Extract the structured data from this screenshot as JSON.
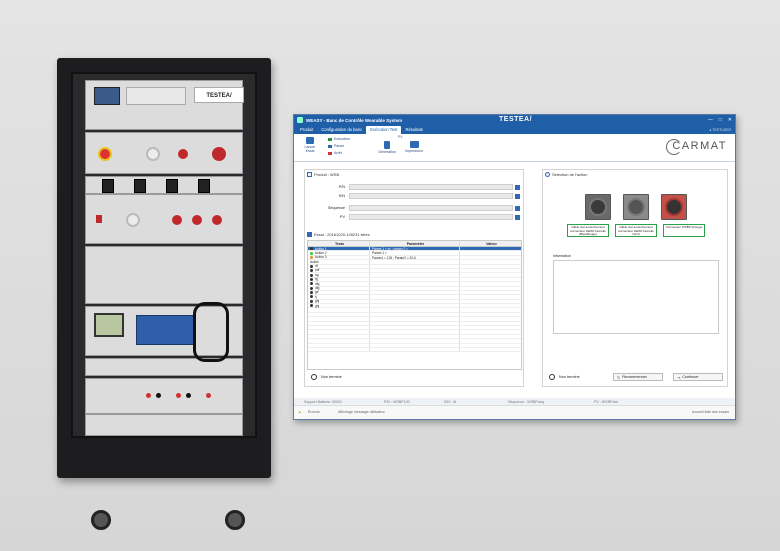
{
  "rack": {
    "brand_plate": "TESTEA/"
  },
  "app": {
    "title": "WEASY - Banc de Contrôle Wearable System",
    "logo": "TESTEA/",
    "window_controls": [
      "—",
      "□",
      "✕"
    ],
    "menu_tabs": [
      {
        "label": "Produit",
        "active": false
      },
      {
        "label": "Configuration du banc",
        "active": false
      },
      {
        "label": "Exécution Test",
        "active": true
      },
      {
        "label": "Résultats",
        "active": false
      }
    ],
    "user": "● TESTUSER",
    "ribbon": {
      "launch": "Lancer\nEssai",
      "controls": [
        "Exécution",
        "Pause",
        "Arrêt"
      ],
      "group_pv": "PV",
      "generation": "Génération",
      "impression": "Impression"
    },
    "brand": "CARMAT",
    "product": {
      "heading": "Produit : WSB",
      "fields": [
        {
          "label": "P/N"
        },
        {
          "label": "S/N"
        },
        {
          "label": "Séquence"
        },
        {
          "label": "PV"
        }
      ]
    },
    "essai": {
      "heading": "Essai : 20161020-145231.btres",
      "columns": [
        "Tests",
        "Paramètre",
        "Valeur"
      ],
      "rows": [
        {
          "name": "Action 1",
          "param": "Param 1 = xx ; param 2 =",
          "value": "",
          "status": "selected"
        },
        {
          "name": "Action 2",
          "param": "Param 1 =",
          "value": "",
          "status": "ok"
        },
        {
          "name": "Action 3",
          "param": "Param1 = 125 ; Param2 = 20.6",
          "value": "",
          "status": "warn"
        },
        {
          "name": "Action",
          "param": "",
          "value": "",
          "status": "none"
        },
        {
          "name": "df",
          "param": "",
          "value": "",
          "status": "dot"
        },
        {
          "name": "cdf",
          "param": "",
          "value": "",
          "status": "dot"
        },
        {
          "name": "ng",
          "param": "",
          "value": "",
          "status": "dot"
        },
        {
          "name": "fg",
          "param": "",
          "value": "",
          "status": "dot"
        },
        {
          "name": "dfg",
          "param": "",
          "value": "",
          "status": "dot"
        },
        {
          "name": "dfg",
          "param": "",
          "value": "",
          "status": "dot"
        },
        {
          "name": "ge",
          "param": "",
          "value": "",
          "status": "dot"
        },
        {
          "name": "fj",
          "param": "",
          "value": "",
          "status": "dot"
        },
        {
          "name": "ghj",
          "param": "",
          "value": "",
          "status": "dot"
        },
        {
          "name": "ghj",
          "param": "",
          "value": "",
          "status": "dot"
        }
      ],
      "footer": "Non terminé"
    },
    "action": {
      "heading": "Sélection de l'action",
      "captions": [
        "Câble test amenchement connecteur LEMO Femelle (Bleu/Rouge)",
        "Câble test amenchement connecteur LEMO Femelle (Vert)",
        "Connecteur WSBP (Rouge)"
      ],
      "info_label": "Information",
      "footer": "Non terminé",
      "restart": "Recommencer",
      "continue": "Continuer"
    },
    "status": {
      "support": "Support Batterie: 00001",
      "pn": "P/N : WSBP100",
      "sn": "S/N : df",
      "seq": "Séquence : WSBP.seq",
      "pv": "PV : WSBP.dot"
    },
    "msg": {
      "level": "Erreurs",
      "text": "Affichage message utilisateur",
      "right": "Accueil liste des essais"
    }
  }
}
